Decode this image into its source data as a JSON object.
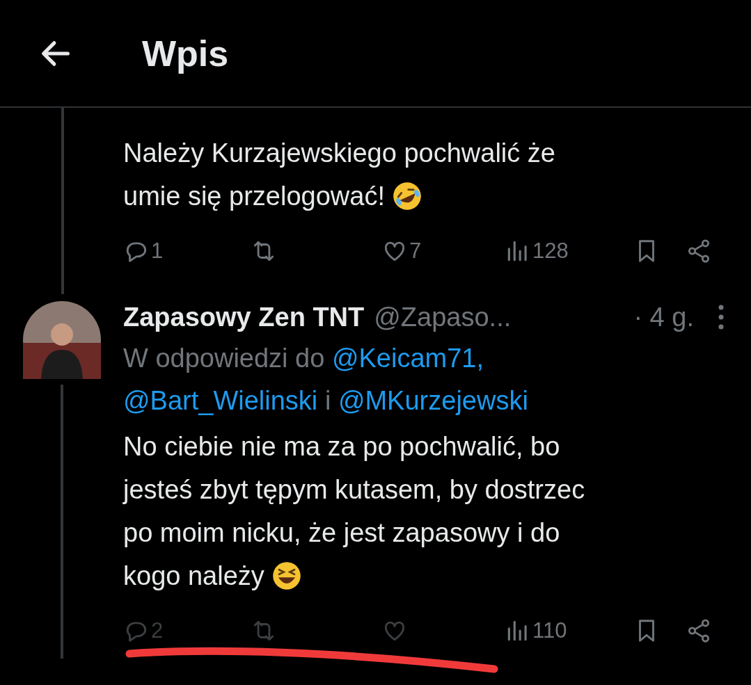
{
  "header": {
    "title": "Wpis"
  },
  "tweets": [
    {
      "has_avatar": false,
      "lines": [
        "Należy Kurzajewskiego pochwalić że",
        "umie się przelogować!"
      ],
      "trailing_icon": {
        "kind": "rofl"
      },
      "actions": [
        {
          "kind": "reply",
          "count": "1",
          "disabled": false
        },
        {
          "kind": "repost",
          "disabled": false
        },
        {
          "kind": "like",
          "count": "7",
          "disabled": false
        },
        {
          "kind": "views",
          "count": "128",
          "disabled": false
        },
        {
          "kind": "bookmark",
          "disabled": false
        },
        {
          "kind": "share",
          "disabled": false
        }
      ]
    },
    {
      "has_avatar": true,
      "name": "Zapasowy Zen TNT",
      "handle": "@Zapaso...",
      "time": "· 4 g.",
      "reply_to": [
        {
          "kind": "plain",
          "text": "W odpowiedzi do"
        },
        {
          "kind": "mention",
          "text": "@Keicam71,"
        },
        {
          "kind": "mention",
          "text": "@Bart_Wielinski"
        },
        {
          "kind": "plain",
          "text": "i"
        },
        {
          "kind": "mention",
          "text": "@MKurzejewski"
        }
      ],
      "lines": [
        "No ciebie nie ma za po pochwalić, bo",
        "jesteś zbyt tępym kutasem, by dostrzec",
        "po moim nicku, że jest zapasowy i do",
        "kogo należy"
      ],
      "trailing_icon": {
        "kind": "laugh"
      },
      "actions": [
        {
          "kind": "reply",
          "count": "2",
          "disabled": true
        },
        {
          "kind": "repost",
          "disabled": true
        },
        {
          "kind": "like",
          "disabled": true
        },
        {
          "kind": "views",
          "count": "110",
          "disabled": false
        },
        {
          "kind": "bookmark",
          "disabled": false
        },
        {
          "kind": "share",
          "disabled": false
        }
      ]
    }
  ]
}
